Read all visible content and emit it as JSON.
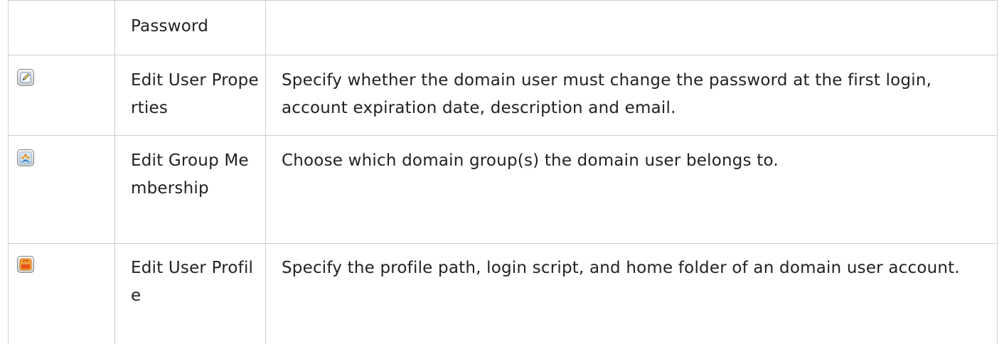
{
  "table": {
    "rows": [
      {
        "icon": "",
        "name": "Password",
        "description": ""
      },
      {
        "icon": "edit-pencil-icon",
        "name": "Edit User Properties",
        "description": "Specify whether the domain user must change the password at the first login, account expiration date, description and email."
      },
      {
        "icon": "group-users-icon",
        "name": "Edit Group Membership",
        "description": "Choose which domain group(s) the domain user belongs to."
      },
      {
        "icon": "user-profile-icon",
        "name": "Edit User Profile",
        "description": "Specify the profile path, login script, and home folder of an domain user account."
      }
    ]
  }
}
